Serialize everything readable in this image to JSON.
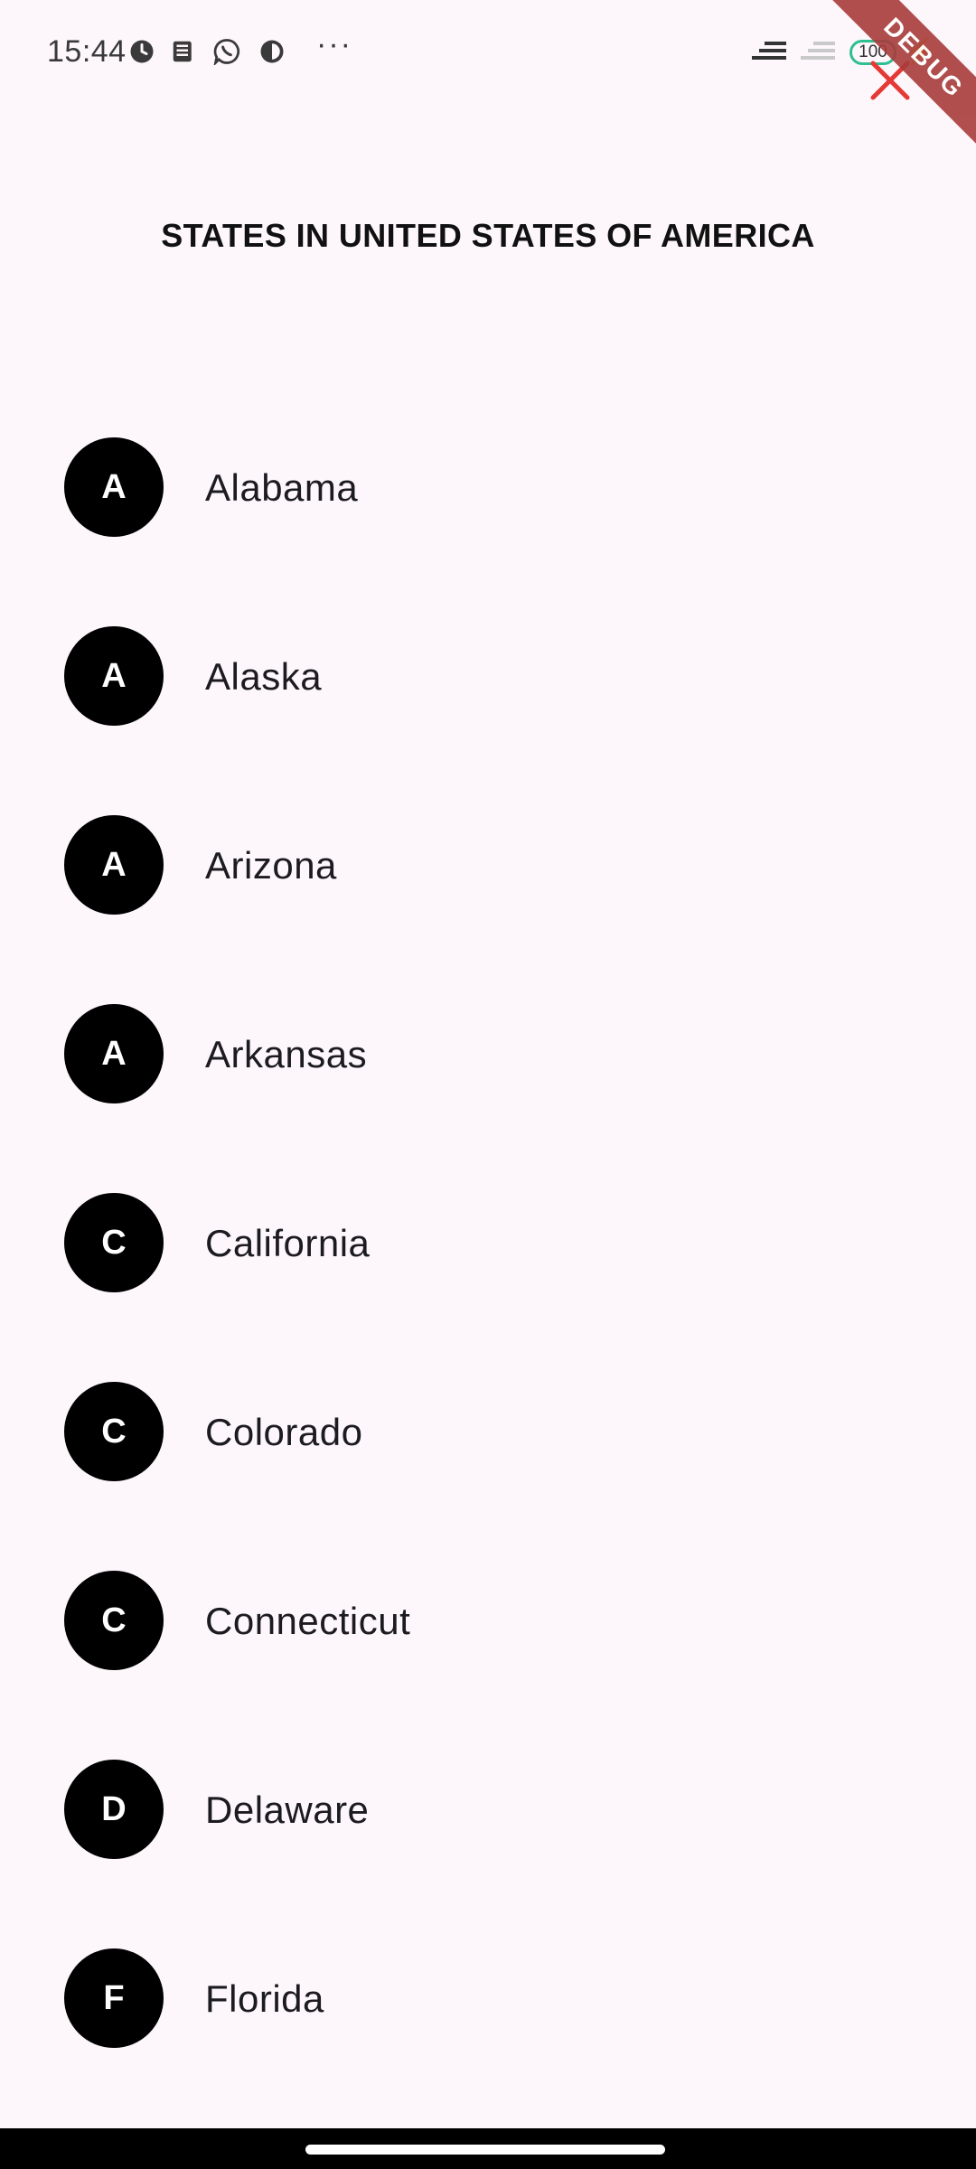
{
  "status_bar": {
    "time": "15:44",
    "more": "···",
    "battery": "100",
    "charging": "⚡",
    "icons": [
      "alarm-icon",
      "news-icon",
      "whatsapp-icon",
      "app-icon",
      "signal-icon",
      "signal-weak-icon",
      "battery-icon"
    ]
  },
  "debug_banner": "DEBUG",
  "title": "STATES IN UNITED STATES OF AMERICA",
  "states": [
    {
      "initial": "A",
      "name": "Alabama"
    },
    {
      "initial": "A",
      "name": "Alaska"
    },
    {
      "initial": "A",
      "name": "Arizona"
    },
    {
      "initial": "A",
      "name": "Arkansas"
    },
    {
      "initial": "C",
      "name": "California"
    },
    {
      "initial": "C",
      "name": "Colorado"
    },
    {
      "initial": "C",
      "name": "Connecticut"
    },
    {
      "initial": "D",
      "name": "Delaware"
    },
    {
      "initial": "F",
      "name": "Florida"
    }
  ],
  "colors": {
    "background": "#fdf7fb",
    "avatar": "#000000",
    "debug_banner": "#a83b3b",
    "close": "#e53935"
  }
}
